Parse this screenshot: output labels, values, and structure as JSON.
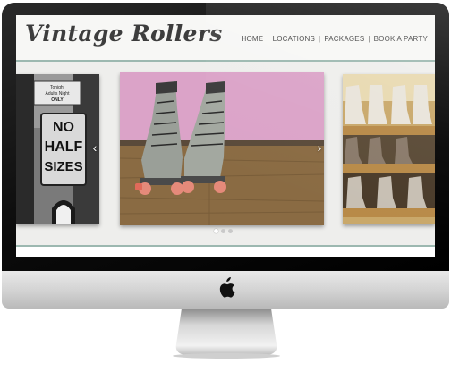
{
  "site": {
    "logo": "Vintage Rollers"
  },
  "nav": {
    "items": [
      {
        "label": "HOME"
      },
      {
        "label": "LOCATIONS"
      },
      {
        "label": "PACKAGES"
      },
      {
        "label": "BOOK A PARTY"
      }
    ],
    "separator": "|"
  },
  "slider": {
    "left_slide": {
      "sign_top_lines": [
        "Tonight",
        "Adults Night",
        "ONLY"
      ],
      "sign_main_lines": [
        "NO",
        "HALF",
        "SIZES"
      ]
    },
    "arrow_left": "‹",
    "arrow_right": "›",
    "dot_count": 3,
    "active_dot": 0
  },
  "colors": {
    "accent_rule": "#9cb8b0",
    "wall_pink": "#dba3c8",
    "floor_wood": "#8a6b43"
  },
  "icons": {
    "device_logo": "apple-icon"
  }
}
